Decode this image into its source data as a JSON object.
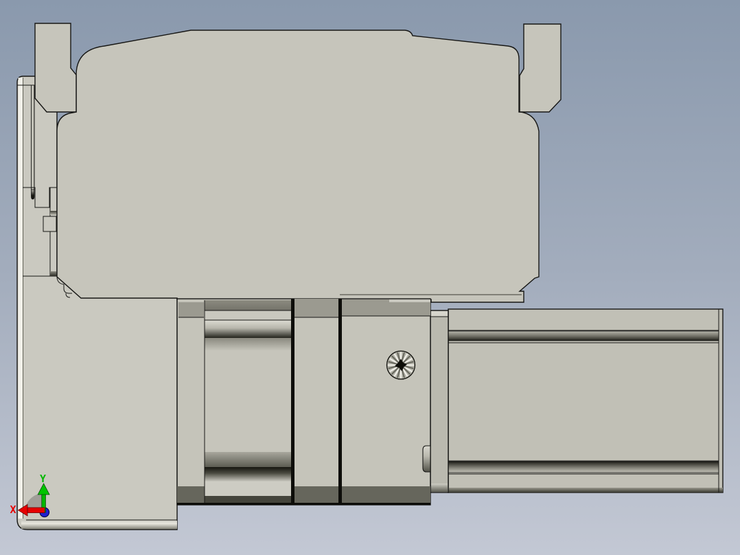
{
  "viewport": {
    "background": {
      "top_color": "#8a99ad",
      "mid_color": "#a3adbd",
      "bottom_color": "#c3c8d4"
    },
    "model": {
      "body_color": "#c6c5bb",
      "plate_color": "#cac9c0",
      "carriage_color": "#c5c4ba",
      "rail_color": "#c1c0b6",
      "edge_color": "#161614",
      "highlight_color": "#f1f0e9",
      "dark_band_color": "#66665c",
      "mid_band_color": "#9b9a90"
    },
    "triad": {
      "x_label": "X",
      "y_label": "Y",
      "x_color": "#e60000",
      "y_color": "#00b800",
      "origin_color": "#2020cf"
    }
  }
}
